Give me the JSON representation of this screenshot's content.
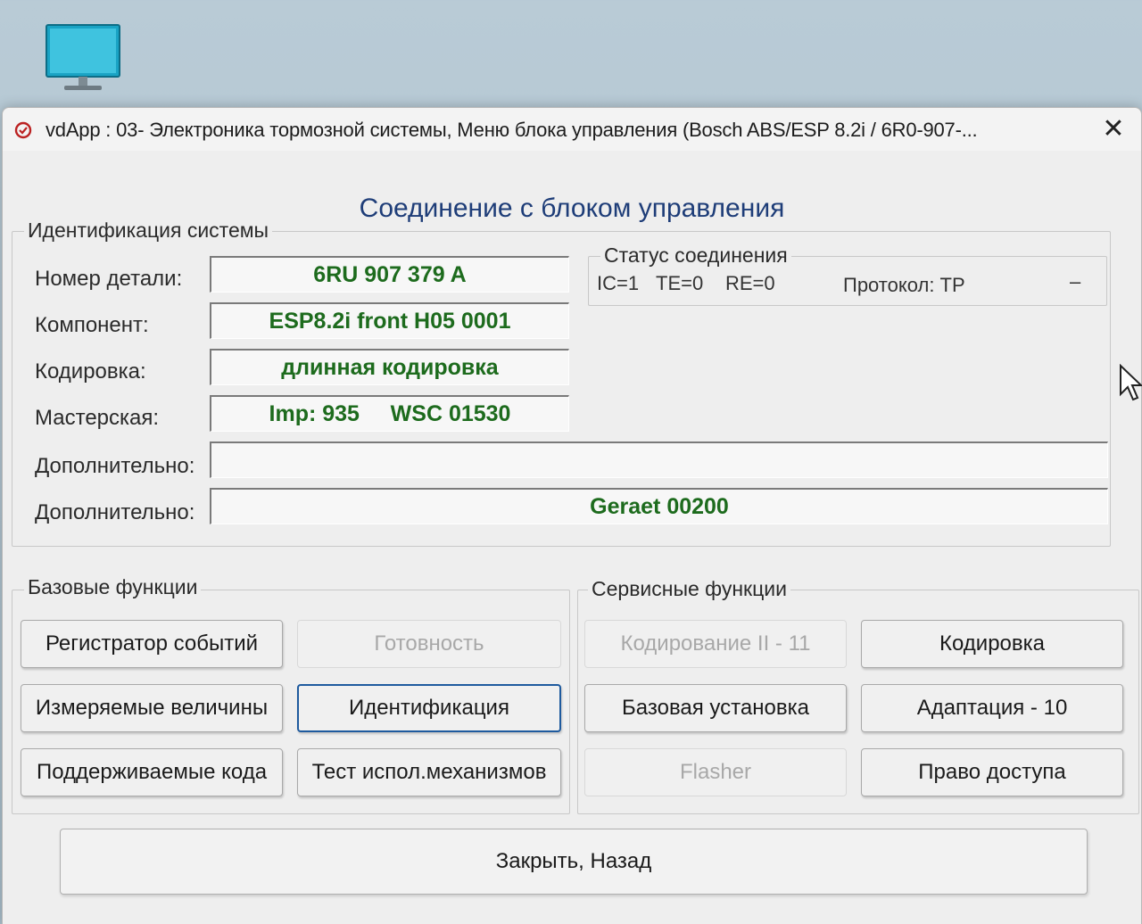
{
  "window": {
    "title": "vdApp : 03- Электроника тормозной системы,  Меню блока управления (Bosch ABS/ESP 8.2i / 6R0-907-...",
    "close_glyph": "✕"
  },
  "main_title": "Соединение с блоком управления",
  "identification": {
    "legend": "Идентификация системы",
    "rows": [
      {
        "label": "Номер детали:",
        "value": "6RU 907 379 A"
      },
      {
        "label": "Компонент:",
        "value": "ESP8.2i front H05 0001"
      },
      {
        "label": "Кодировка:",
        "value": "длинная кодировка"
      },
      {
        "label": "Мастерская:",
        "value": "Imp: 935     WSC 01530"
      },
      {
        "label": "Дополнительно:",
        "value": ""
      },
      {
        "label": "Дополнительно:",
        "value": "Geraet 00200"
      }
    ]
  },
  "connection_status": {
    "legend": "Статус соединения",
    "ic": "IC=1",
    "te": "TE=0",
    "re": "RE=0",
    "protocol": "Протокол: TP",
    "indicator": "–"
  },
  "basic_functions": {
    "legend": "Базовые функции",
    "buttons": [
      {
        "label": "Регистратор событий",
        "enabled": true
      },
      {
        "label": "Готовность",
        "enabled": false
      },
      {
        "label": "Измеряемые величины",
        "enabled": true
      },
      {
        "label": "Идентификация",
        "enabled": true,
        "focused": true
      },
      {
        "label": "Поддерживаемые кода",
        "enabled": true
      },
      {
        "label": "Тест испол.механизмов",
        "enabled": true
      }
    ]
  },
  "service_functions": {
    "legend": "Сервисные функции",
    "buttons": [
      {
        "label": "Кодирование II - 11",
        "enabled": false
      },
      {
        "label": "Кодировка",
        "enabled": true
      },
      {
        "label": "Базовая установка",
        "enabled": true
      },
      {
        "label": "Адаптация - 10",
        "enabled": true
      },
      {
        "label": "Flasher",
        "enabled": false
      },
      {
        "label": "Право доступа",
        "enabled": true
      }
    ]
  },
  "footer": {
    "close_back_label": "Закрыть, Назад"
  },
  "colors": {
    "value_text": "#1d6b1d",
    "title_blue": "#1e3d78",
    "focus_border": "#1e5a9e"
  }
}
